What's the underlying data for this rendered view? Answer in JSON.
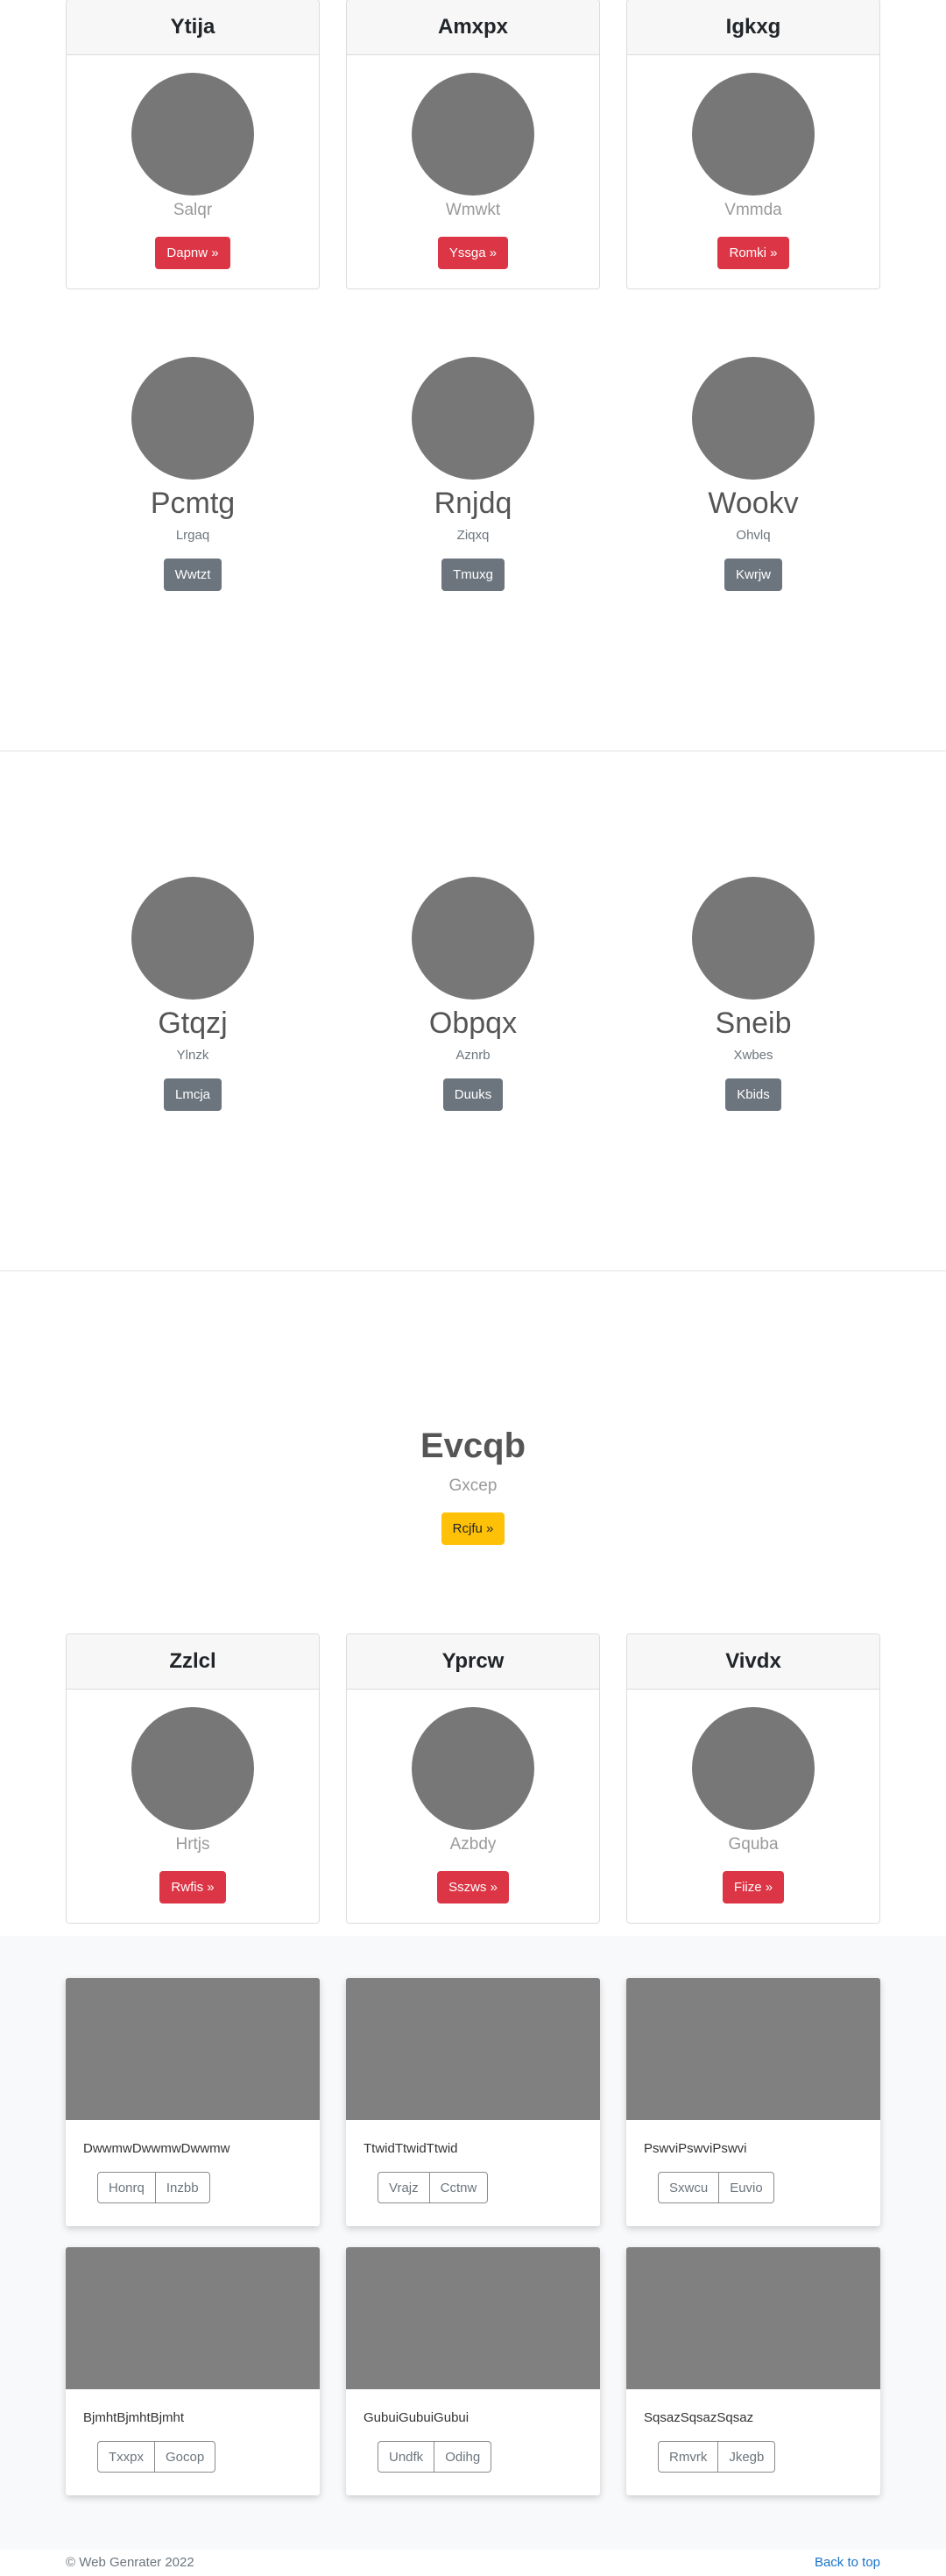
{
  "top_cards": [
    {
      "title": "Ytija",
      "subtitle": "Salqr",
      "button": "Dapnw »"
    },
    {
      "title": "Amxpx",
      "subtitle": "Wmwkt",
      "button": "Yssga »"
    },
    {
      "title": "Igkxg",
      "subtitle": "Vmmda",
      "button": "Romki »"
    }
  ],
  "team_1": [
    {
      "name": "Pcmtg",
      "role": "Lrgaq",
      "button": "Wwtzt"
    },
    {
      "name": "Rnjdq",
      "role": "Ziqxq",
      "button": "Tmuxg"
    },
    {
      "name": "Wookv",
      "role": "Ohvlq",
      "button": "Kwrjw"
    }
  ],
  "team_2": [
    {
      "name": "Gtqzj",
      "role": "Ylnzk",
      "button": "Lmcja"
    },
    {
      "name": "Obpqx",
      "role": "Aznrb",
      "button": "Duuks"
    },
    {
      "name": "Sneib",
      "role": "Xwbes",
      "button": "Kbids"
    }
  ],
  "hero": {
    "title": "Evcqb",
    "subtitle": "Gxcep",
    "button": "Rcjfu »"
  },
  "bottom_cards": [
    {
      "title": "Zzlcl",
      "subtitle": "Hrtjs",
      "button": "Rwfis »"
    },
    {
      "title": "Yprcw",
      "subtitle": "Azbdy",
      "button": "Sszws »"
    },
    {
      "title": "Vivdx",
      "subtitle": "Gquba",
      "button": "Fiize »"
    }
  ],
  "album": [
    {
      "text": "DwwmwDwwmwDwwmw",
      "btn1": "Honrq",
      "btn2": "Inzbb"
    },
    {
      "text": "TtwidTtwidTtwid",
      "btn1": "Vrajz",
      "btn2": "Cctnw"
    },
    {
      "text": "PswviPswviPswvi",
      "btn1": "Sxwcu",
      "btn2": "Euvio"
    },
    {
      "text": "BjmhtBjmhtBjmht",
      "btn1": "Txxpx",
      "btn2": "Gocop"
    },
    {
      "text": "GubuiGubuiGubui",
      "btn1": "Undfk",
      "btn2": "Odihg"
    },
    {
      "text": "SqsazSqsazSqsaz",
      "btn1": "Rmvrk",
      "btn2": "Jkegb"
    }
  ],
  "footer": {
    "copyright": "© Web Genrater 2022",
    "back_to_top": "Back to top"
  },
  "colors": {
    "danger": "#dc3545",
    "secondary": "#6c757d",
    "warning": "#ffc107",
    "placeholder": "#777777",
    "link": "#1a73c8"
  }
}
